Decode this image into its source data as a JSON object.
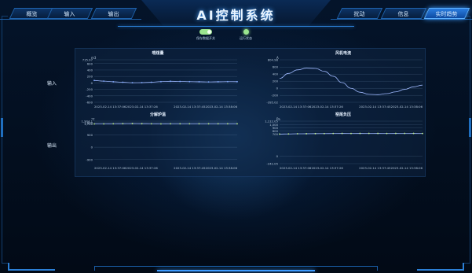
{
  "app": {
    "title": "AI控制系统"
  },
  "nav_left": [
    {
      "label": "概览",
      "active": false
    },
    {
      "label": "输入",
      "active": false
    },
    {
      "label": "输出",
      "active": false
    }
  ],
  "nav_right": [
    {
      "label": "扰动",
      "active": false
    },
    {
      "label": "信息",
      "active": false
    },
    {
      "label": "实时趋势",
      "active": true
    }
  ],
  "toggles": [
    {
      "label": "保存数据开关",
      "kind": "switch",
      "on": true,
      "color": "#9be58f"
    },
    {
      "label": "运行状态",
      "kind": "indicator",
      "on": true,
      "color": "#9be58f"
    }
  ],
  "row_labels": {
    "input": "输入",
    "output": "输出"
  },
  "colors": {
    "line": "#9fb9ff",
    "marker_input": "#7fa8ff",
    "marker_output": "#bff28a",
    "axis_text": "#b6c9dd",
    "grid": "#8fb2d8"
  },
  "chart_data": [
    {
      "type": "line",
      "title": "喂煤量",
      "unit": "m3",
      "y_labels": [
        "715.97",
        "600",
        "400",
        "200",
        "0",
        "-200",
        "-400",
        "-600"
      ],
      "ylim": [
        -600,
        715.97
      ],
      "x_labels": [
        "2023-02-14 13:37:06",
        "2023-02-14 13:37:26",
        "2023-02-14 13:37:45",
        "2023-02-14 13:38:06"
      ],
      "values": [
        75,
        55,
        35,
        20,
        5,
        8,
        20,
        40,
        50,
        45,
        40,
        35,
        30,
        35,
        40,
        38
      ],
      "markers": true,
      "marker_color": "#7fa8ff",
      "grid": true
    },
    {
      "type": "line",
      "title": "风机电流",
      "unit": "A",
      "y_labels": [
        "804.98",
        "600",
        "400",
        "200",
        "0",
        "-200",
        "-395.02"
      ],
      "ylim": [
        -395.02,
        804.98
      ],
      "x_labels": [
        "2023-02-14 13:37:06",
        "2023-02-14 13:37:26",
        "2023-02-14 13:37:45",
        "2023-02-14 13:38:06"
      ],
      "values": [
        280,
        420,
        520,
        570,
        560,
        480,
        340,
        160,
        0,
        -110,
        -170,
        -180,
        -150,
        -100,
        -30,
        40,
        90
      ],
      "markers": false,
      "marker_color": "#7fa8ff",
      "grid": true
    },
    {
      "type": "line",
      "title": "分解炉温",
      "unit": "℃",
      "y_labels": [
        "1,904.1",
        "1,800",
        "1,700",
        "900",
        "0",
        "-900"
      ],
      "ylim": [
        -1200,
        1904.1
      ],
      "x_labels": [
        "2023-02-14 13:37:06",
        "2023-02-14 13:37:26",
        "2023-02-14 13:37:45",
        "2023-02-14 13:38:06"
      ],
      "values": [
        1700,
        1705,
        1710,
        1715,
        1720,
        1715,
        1710,
        1705,
        1708,
        1710,
        1712,
        1710,
        1708,
        1710,
        1712,
        1710
      ],
      "markers": true,
      "marker_color": "#bff28a",
      "grid": true
    },
    {
      "type": "line",
      "title": "窑尾负压",
      "unit": "Pa",
      "y_labels": [
        "1,112.05",
        "1,000",
        "900",
        "800",
        "700",
        "0",
        "-242.05"
      ],
      "ylim": [
        -242.05,
        1112.05
      ],
      "x_labels": [
        "2023-02-14 13:37:06",
        "2023-02-14 13:37:26",
        "2023-02-14 13:37:45",
        "2023-02-14 13:38:06"
      ],
      "values": [
        700,
        705,
        710,
        712,
        715,
        718,
        720,
        722,
        720,
        722,
        724,
        722,
        720,
        722,
        724,
        722,
        720
      ],
      "markers": true,
      "marker_color": "#bff28a",
      "grid": true
    }
  ]
}
